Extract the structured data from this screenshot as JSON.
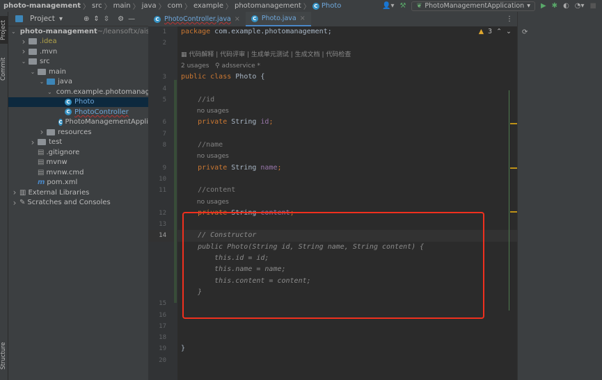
{
  "breadcrumb": [
    "photo-management",
    "src",
    "main",
    "java",
    "com",
    "example",
    "photomanagement",
    "Photo"
  ],
  "run_config": "PhotoManagementApplication",
  "side_strip": {
    "project": "Project",
    "commit": "Commit",
    "structure": "Structure"
  },
  "project_panel": {
    "title": "Project",
    "tree": [
      {
        "label": "photo-management",
        "extra": "~/leansoftx/aise-",
        "arrow": "v",
        "indent": 0,
        "icon": "module"
      },
      {
        "label": ".idea",
        "arrow": ">",
        "indent": 1,
        "icon": "folder",
        "color": "#b0a14a"
      },
      {
        "label": ".mvn",
        "arrow": ">",
        "indent": 1,
        "icon": "folder"
      },
      {
        "label": "src",
        "arrow": "v",
        "indent": 1,
        "icon": "folder"
      },
      {
        "label": "main",
        "arrow": "v",
        "indent": 2,
        "icon": "folder"
      },
      {
        "label": "java",
        "arrow": "v",
        "indent": 3,
        "icon": "folder-blue"
      },
      {
        "label": "com.example.photomanage",
        "arrow": "v",
        "indent": 4,
        "icon": "package"
      },
      {
        "label": "Photo",
        "indent": 5,
        "icon": "class",
        "color": "#6fa8dc",
        "selected": true
      },
      {
        "label": "PhotoController",
        "indent": 5,
        "icon": "class",
        "color": "#6fa8dc"
      },
      {
        "label": "PhotoManagementAppli",
        "indent": 5,
        "icon": "class"
      },
      {
        "label": "resources",
        "arrow": ">",
        "indent": 3,
        "icon": "folder"
      },
      {
        "label": "test",
        "arrow": ">",
        "indent": 2,
        "icon": "folder"
      },
      {
        "label": ".gitignore",
        "indent": 2,
        "icon": "file"
      },
      {
        "label": "mvnw",
        "indent": 2,
        "icon": "file"
      },
      {
        "label": "mvnw.cmd",
        "indent": 2,
        "icon": "file"
      },
      {
        "label": "pom.xml",
        "indent": 2,
        "icon": "maven"
      },
      {
        "label": "External Libraries",
        "arrow": ">",
        "indent": 0,
        "icon": "library"
      },
      {
        "label": "Scratches and Consoles",
        "arrow": ">",
        "indent": 0,
        "icon": "scratch"
      }
    ]
  },
  "tabs": [
    {
      "label": "PhotoController.java",
      "active": false
    },
    {
      "label": "Photo.java",
      "active": true
    }
  ],
  "inspections": {
    "warnings": "3"
  },
  "code_rows": [
    {
      "n": "1",
      "t": [
        [
          "kw",
          "package "
        ],
        [
          "tx",
          "com.example.photomanagement;"
        ]
      ]
    },
    {
      "n": "2",
      "t": []
    },
    {
      "n": "",
      "t": [
        [
          "hint",
          "▦ 代码解释 | 代码评审 | 生成单元测试 | 生成文档 | 代码检查"
        ]
      ]
    },
    {
      "n": "",
      "t": [
        [
          "hint",
          "2 usages   ⚲ adsservice *"
        ]
      ]
    },
    {
      "n": "3",
      "t": [
        [
          "kw",
          "public class "
        ],
        [
          "tx",
          "Photo {"
        ]
      ]
    },
    {
      "n": "4",
      "t": []
    },
    {
      "n": "5",
      "t": [
        [
          "cm",
          "    //id"
        ]
      ]
    },
    {
      "n": "",
      "t": [
        [
          "hint",
          "        no usages"
        ]
      ]
    },
    {
      "n": "6",
      "t": [
        [
          "kw",
          "    private "
        ],
        [
          "tx",
          "String "
        ],
        [
          "fd",
          "id"
        ],
        [
          "kw",
          ";"
        ]
      ]
    },
    {
      "n": "7",
      "t": []
    },
    {
      "n": "8",
      "t": [
        [
          "cm",
          "    //name"
        ]
      ]
    },
    {
      "n": "",
      "t": [
        [
          "hint",
          "        no usages"
        ]
      ]
    },
    {
      "n": "9",
      "t": [
        [
          "kw",
          "    private "
        ],
        [
          "tx",
          "String "
        ],
        [
          "fd",
          "name"
        ],
        [
          "kw",
          ";"
        ]
      ]
    },
    {
      "n": "10",
      "t": []
    },
    {
      "n": "11",
      "t": [
        [
          "cm",
          "    //content"
        ]
      ]
    },
    {
      "n": "",
      "t": [
        [
          "hint",
          "        no usages"
        ]
      ]
    },
    {
      "n": "12",
      "t": [
        [
          "kw",
          "    private "
        ],
        [
          "tx",
          "String "
        ],
        [
          "fd",
          "content"
        ],
        [
          "kw",
          ";"
        ]
      ]
    },
    {
      "n": "13",
      "t": []
    },
    {
      "n": "14",
      "cur": true,
      "t": [
        [
          "ghost",
          "    // Constructor"
        ]
      ]
    },
    {
      "n": "",
      "t": [
        [
          "ghost",
          "    public Photo(String id, String name, String content) {"
        ]
      ]
    },
    {
      "n": "",
      "t": [
        [
          "ghost",
          "        this.id = id;"
        ]
      ]
    },
    {
      "n": "",
      "t": [
        [
          "ghost",
          "        this.name = name;"
        ]
      ]
    },
    {
      "n": "",
      "t": [
        [
          "ghost",
          "        this.content = content;"
        ]
      ]
    },
    {
      "n": "",
      "t": [
        [
          "ghost",
          "    }"
        ]
      ]
    },
    {
      "n": "15",
      "t": []
    },
    {
      "n": "16",
      "t": []
    },
    {
      "n": "17",
      "t": []
    },
    {
      "n": "18",
      "t": []
    },
    {
      "n": "19",
      "t": [
        [
          "tx",
          "}"
        ]
      ]
    },
    {
      "n": "20",
      "t": []
    }
  ],
  "colors": {
    "highlight_box": "#f0301e",
    "accent": "#4a88c7",
    "selection": "#0d293e"
  }
}
